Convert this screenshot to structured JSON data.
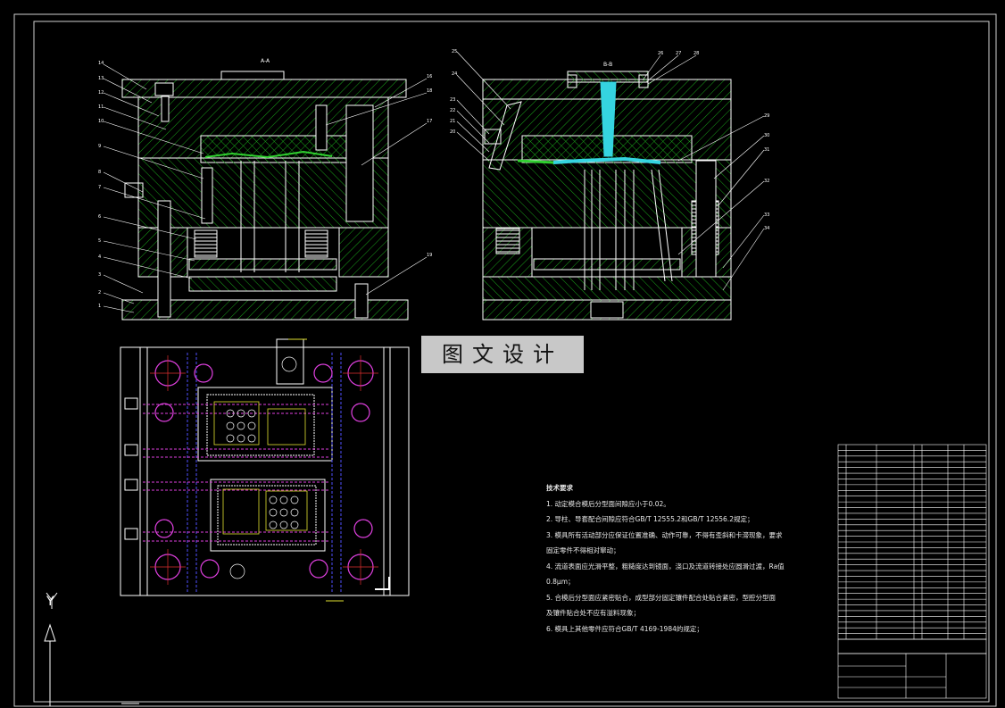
{
  "stamp": {
    "text": "图文设计"
  },
  "section_labels": {
    "left": "A-A",
    "right": "B-B"
  },
  "technical_requirements": {
    "title": "技术要求",
    "items": [
      "1. 动定模合模后分型面间隙应小于0.02。",
      "2. 导柱、导套配合间隙应符合GB/T 12555.2和GB/T 12556.2规定；",
      "3. 模具所有活动部分应保证位置准确、动作可靠，不得有歪斜和卡滞现象，要求",
      "    固定零件不得相对窜动；",
      "4. 流道表面应光滑平整，粗糙度达到镜面，浇口及流道转接处应圆滑过渡，Ra值",
      "    0.8μm；",
      "5. 合模后分型面应紧密贴合，成型部分固定镶件配合处贴合紧密，型腔分型面",
      "    及镶件贴合处不应有溢料现象；",
      "6. 模具上其他零件应符合GB/T 4169-1984的规定；"
    ]
  },
  "axis_labels": {
    "y": "Y"
  },
  "left_part_numbers": [
    "14",
    "13",
    "12",
    "11",
    "10",
    "9",
    "8",
    "7",
    "6",
    "5",
    "4",
    "3",
    "2",
    "1"
  ],
  "left_right_part_numbers": [
    "16",
    "18",
    "17",
    "19"
  ],
  "right_part_numbers_left": [
    "25",
    "24",
    "23",
    "22",
    "21",
    "20"
  ],
  "right_part_numbers_top": [
    "26",
    "27",
    "28"
  ],
  "right_part_numbers_right": [
    "29",
    "30",
    "31",
    "32",
    "33",
    "34"
  ],
  "bom_rows": 34,
  "colors": {
    "outline": "#ffffff",
    "hatch": "#1aa31a",
    "cyan": "#35d4e0",
    "magenta": "#e040e0",
    "blue": "#5050ff",
    "yellow": "#e0e030",
    "red": "#e03030"
  }
}
